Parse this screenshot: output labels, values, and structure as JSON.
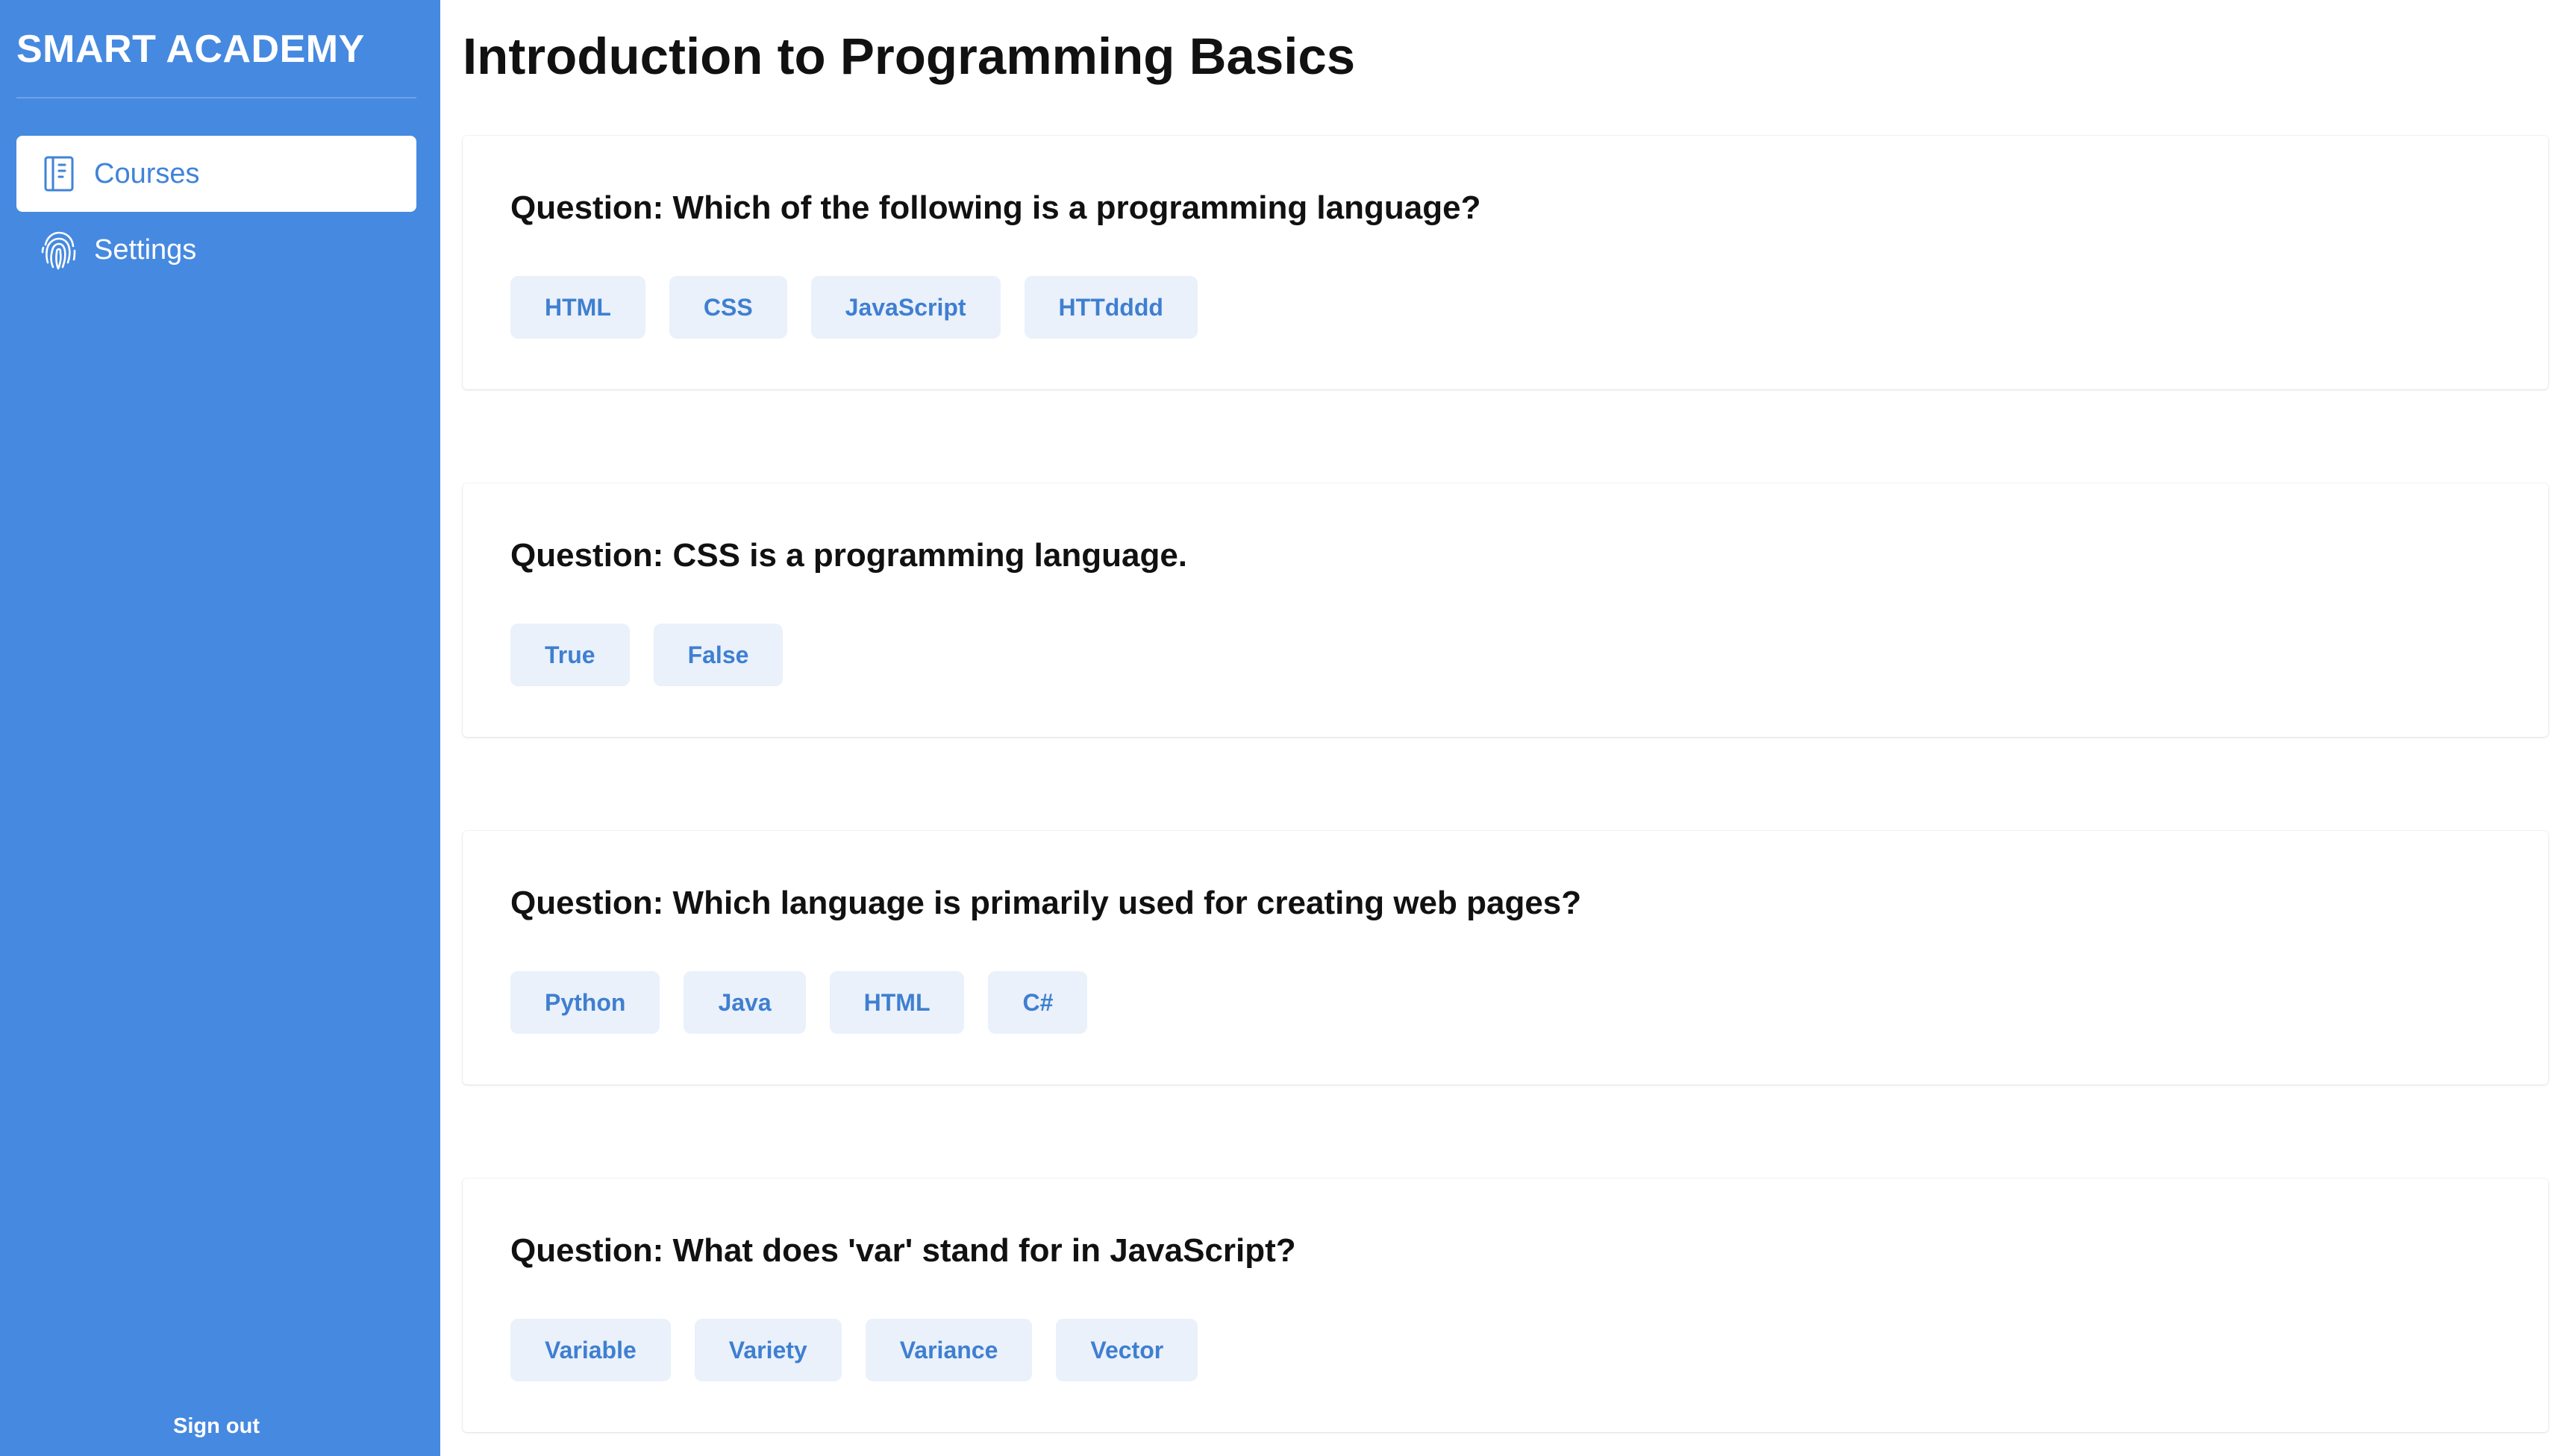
{
  "sidebar": {
    "brand": "SMART ACADEMY",
    "items": [
      {
        "label": "Courses",
        "icon": "book-icon",
        "active": true
      },
      {
        "label": "Settings",
        "icon": "fingerprint-icon",
        "active": false
      }
    ],
    "signout": "Sign out"
  },
  "main": {
    "title": "Introduction to Programming Basics",
    "questions": [
      {
        "text": "Question: Which of the following is a programming language?",
        "options": [
          "HTML",
          "CSS",
          "JavaScript",
          "HTTdddd"
        ]
      },
      {
        "text": "Question: CSS is a programming language.",
        "options": [
          "True",
          "False"
        ]
      },
      {
        "text": "Question: Which language is primarily used for creating web pages?",
        "options": [
          "Python",
          "Java",
          "HTML",
          "C#"
        ]
      },
      {
        "text": "Question: What does 'var' stand for in JavaScript?",
        "options": [
          "Variable",
          "Variety",
          "Variance",
          "Vector"
        ]
      }
    ]
  },
  "colors": {
    "sidebar": "#4689e0",
    "accent": "#3f83d9",
    "option_bg": "#eaf1fb",
    "option_text": "#3f7fd1"
  }
}
